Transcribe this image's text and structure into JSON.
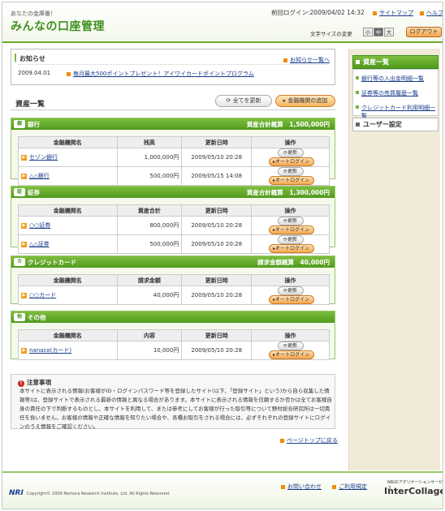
{
  "header": {
    "tagline": "あなたの金庫番！",
    "logo_main": "みんなの",
    "logo_accent": "口座管理",
    "last_login": "前回ログイン:2009/04/02  14:32",
    "sitemap": "サイトマップ",
    "help": "ヘルプ",
    "font_size_label": "文字サイズの変更",
    "font_small": "小",
    "font_medium": "中",
    "font_large": "大",
    "logout": "ログアウト"
  },
  "notice": {
    "title": "お知らせ",
    "more": "お知らせ一覧へ",
    "date": "2009.04.01",
    "text": "毎月最大500ポイントプレゼント！アイワイカードポイントプログラム"
  },
  "assets": {
    "title": "資産一覧",
    "update_all": "全てを更新",
    "add_institution": "金融機関の追加"
  },
  "row_actions": {
    "update": "更新",
    "autologin": "オートログイン"
  },
  "categories": [
    {
      "name": "銀行",
      "icon": "銀",
      "total_label": "資産合計概算",
      "total": "1,500,000円",
      "headers": [
        "金融機関名",
        "残高",
        "更新日時",
        "操作"
      ],
      "rows": [
        {
          "name": "セゾン銀行",
          "amount": "1,000,000円",
          "date": "2009/05/10  20:28"
        },
        {
          "name": "△△銀行",
          "amount": "500,000円",
          "date": "2009/05/15  14:08"
        }
      ]
    },
    {
      "name": "証券",
      "icon": "証",
      "total_label": "資産合計概算",
      "total": "1,300,000円",
      "headers": [
        "金融機関名",
        "資産合計",
        "更新日時",
        "操作"
      ],
      "rows": [
        {
          "name": "○○証券",
          "amount": "800,000円",
          "date": "2009/05/10  20:28"
        },
        {
          "name": "△△証券",
          "amount": "500,000円",
          "date": "2009/05/10  20:28"
        }
      ]
    },
    {
      "name": "クレジットカード",
      "icon": "カ",
      "total_label": "請求金額概算",
      "total": "40,000円",
      "headers": [
        "金融機関名",
        "請求金額",
        "更新日時",
        "操作"
      ],
      "rows": [
        {
          "name": "○○カード",
          "amount": "40,000円",
          "date": "2009/05/10  20:28"
        }
      ]
    },
    {
      "name": "その他",
      "icon": "他",
      "total_label": "",
      "total": "",
      "headers": [
        "金融機関名",
        "内容",
        "更新日時",
        "操作"
      ],
      "rows": [
        {
          "name": "nanaco(カード)",
          "amount": "10,000円",
          "date": "2009/05/10  20:28"
        }
      ]
    }
  ],
  "caution": {
    "title": "注意事項",
    "body": "本サイトに表示される情報(お客様がID・ログインパスワード等を登録したサイト(以下、「登録サイト」という)から自ら収集した情報等)は、登録サイトで表示される最新の情報と異なる場合があります。本サイトに表示される情報を信頼するか否かは全てお客様自身の責任の下で判断するものとし、本サイトを利用して、または参考にしてお客様が行った取引等について野村総合研究所は一切責任を負いません。お客様の情報や正確な情報を知りたい場合や、各種お取引をされる場合には、必ずそれぞれの登録サイトにログインのうえ情報をご確認ください。"
  },
  "page_top": "ページトップに戻る",
  "sidebar": {
    "heading": "資産一覧",
    "items": [
      "銀行等の入出金明細一覧",
      "証券等の売買履歴一覧",
      "クレジットカード利用明細一覧"
    ],
    "user_settings": "ユーザー設定"
  },
  "footer": {
    "nri": "NRI",
    "copyright": "Copyright© 2009 Nomura Research Institute, Ltd. All Rights Reserved.",
    "contact": "お問い合わせ",
    "terms": "ご利用規定",
    "brand_small": "NRIのアグリゲーションサービス",
    "brand": "InterCollage"
  }
}
